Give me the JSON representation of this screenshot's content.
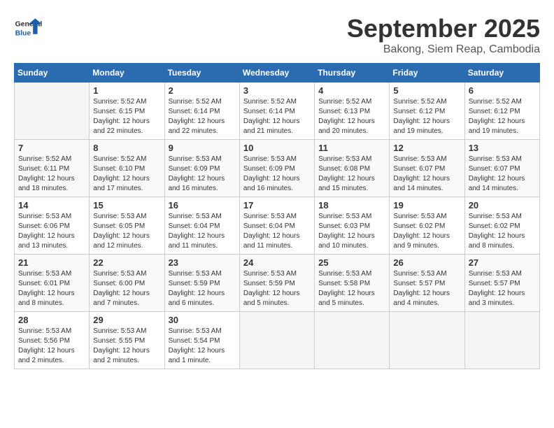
{
  "header": {
    "logo_general": "General",
    "logo_blue": "Blue",
    "month": "September 2025",
    "location": "Bakong, Siem Reap, Cambodia"
  },
  "days_of_week": [
    "Sunday",
    "Monday",
    "Tuesday",
    "Wednesday",
    "Thursday",
    "Friday",
    "Saturday"
  ],
  "weeks": [
    [
      {
        "day": "",
        "info": ""
      },
      {
        "day": "1",
        "info": "Sunrise: 5:52 AM\nSunset: 6:15 PM\nDaylight: 12 hours\nand 22 minutes."
      },
      {
        "day": "2",
        "info": "Sunrise: 5:52 AM\nSunset: 6:14 PM\nDaylight: 12 hours\nand 22 minutes."
      },
      {
        "day": "3",
        "info": "Sunrise: 5:52 AM\nSunset: 6:14 PM\nDaylight: 12 hours\nand 21 minutes."
      },
      {
        "day": "4",
        "info": "Sunrise: 5:52 AM\nSunset: 6:13 PM\nDaylight: 12 hours\nand 20 minutes."
      },
      {
        "day": "5",
        "info": "Sunrise: 5:52 AM\nSunset: 6:12 PM\nDaylight: 12 hours\nand 19 minutes."
      },
      {
        "day": "6",
        "info": "Sunrise: 5:52 AM\nSunset: 6:12 PM\nDaylight: 12 hours\nand 19 minutes."
      }
    ],
    [
      {
        "day": "7",
        "info": "Sunrise: 5:52 AM\nSunset: 6:11 PM\nDaylight: 12 hours\nand 18 minutes."
      },
      {
        "day": "8",
        "info": "Sunrise: 5:52 AM\nSunset: 6:10 PM\nDaylight: 12 hours\nand 17 minutes."
      },
      {
        "day": "9",
        "info": "Sunrise: 5:53 AM\nSunset: 6:09 PM\nDaylight: 12 hours\nand 16 minutes."
      },
      {
        "day": "10",
        "info": "Sunrise: 5:53 AM\nSunset: 6:09 PM\nDaylight: 12 hours\nand 16 minutes."
      },
      {
        "day": "11",
        "info": "Sunrise: 5:53 AM\nSunset: 6:08 PM\nDaylight: 12 hours\nand 15 minutes."
      },
      {
        "day": "12",
        "info": "Sunrise: 5:53 AM\nSunset: 6:07 PM\nDaylight: 12 hours\nand 14 minutes."
      },
      {
        "day": "13",
        "info": "Sunrise: 5:53 AM\nSunset: 6:07 PM\nDaylight: 12 hours\nand 14 minutes."
      }
    ],
    [
      {
        "day": "14",
        "info": "Sunrise: 5:53 AM\nSunset: 6:06 PM\nDaylight: 12 hours\nand 13 minutes."
      },
      {
        "day": "15",
        "info": "Sunrise: 5:53 AM\nSunset: 6:05 PM\nDaylight: 12 hours\nand 12 minutes."
      },
      {
        "day": "16",
        "info": "Sunrise: 5:53 AM\nSunset: 6:04 PM\nDaylight: 12 hours\nand 11 minutes."
      },
      {
        "day": "17",
        "info": "Sunrise: 5:53 AM\nSunset: 6:04 PM\nDaylight: 12 hours\nand 11 minutes."
      },
      {
        "day": "18",
        "info": "Sunrise: 5:53 AM\nSunset: 6:03 PM\nDaylight: 12 hours\nand 10 minutes."
      },
      {
        "day": "19",
        "info": "Sunrise: 5:53 AM\nSunset: 6:02 PM\nDaylight: 12 hours\nand 9 minutes."
      },
      {
        "day": "20",
        "info": "Sunrise: 5:53 AM\nSunset: 6:02 PM\nDaylight: 12 hours\nand 8 minutes."
      }
    ],
    [
      {
        "day": "21",
        "info": "Sunrise: 5:53 AM\nSunset: 6:01 PM\nDaylight: 12 hours\nand 8 minutes."
      },
      {
        "day": "22",
        "info": "Sunrise: 5:53 AM\nSunset: 6:00 PM\nDaylight: 12 hours\nand 7 minutes."
      },
      {
        "day": "23",
        "info": "Sunrise: 5:53 AM\nSunset: 5:59 PM\nDaylight: 12 hours\nand 6 minutes."
      },
      {
        "day": "24",
        "info": "Sunrise: 5:53 AM\nSunset: 5:59 PM\nDaylight: 12 hours\nand 5 minutes."
      },
      {
        "day": "25",
        "info": "Sunrise: 5:53 AM\nSunset: 5:58 PM\nDaylight: 12 hours\nand 5 minutes."
      },
      {
        "day": "26",
        "info": "Sunrise: 5:53 AM\nSunset: 5:57 PM\nDaylight: 12 hours\nand 4 minutes."
      },
      {
        "day": "27",
        "info": "Sunrise: 5:53 AM\nSunset: 5:57 PM\nDaylight: 12 hours\nand 3 minutes."
      }
    ],
    [
      {
        "day": "28",
        "info": "Sunrise: 5:53 AM\nSunset: 5:56 PM\nDaylight: 12 hours\nand 2 minutes."
      },
      {
        "day": "29",
        "info": "Sunrise: 5:53 AM\nSunset: 5:55 PM\nDaylight: 12 hours\nand 2 minutes."
      },
      {
        "day": "30",
        "info": "Sunrise: 5:53 AM\nSunset: 5:54 PM\nDaylight: 12 hours\nand 1 minute."
      },
      {
        "day": "",
        "info": ""
      },
      {
        "day": "",
        "info": ""
      },
      {
        "day": "",
        "info": ""
      },
      {
        "day": "",
        "info": ""
      }
    ]
  ]
}
